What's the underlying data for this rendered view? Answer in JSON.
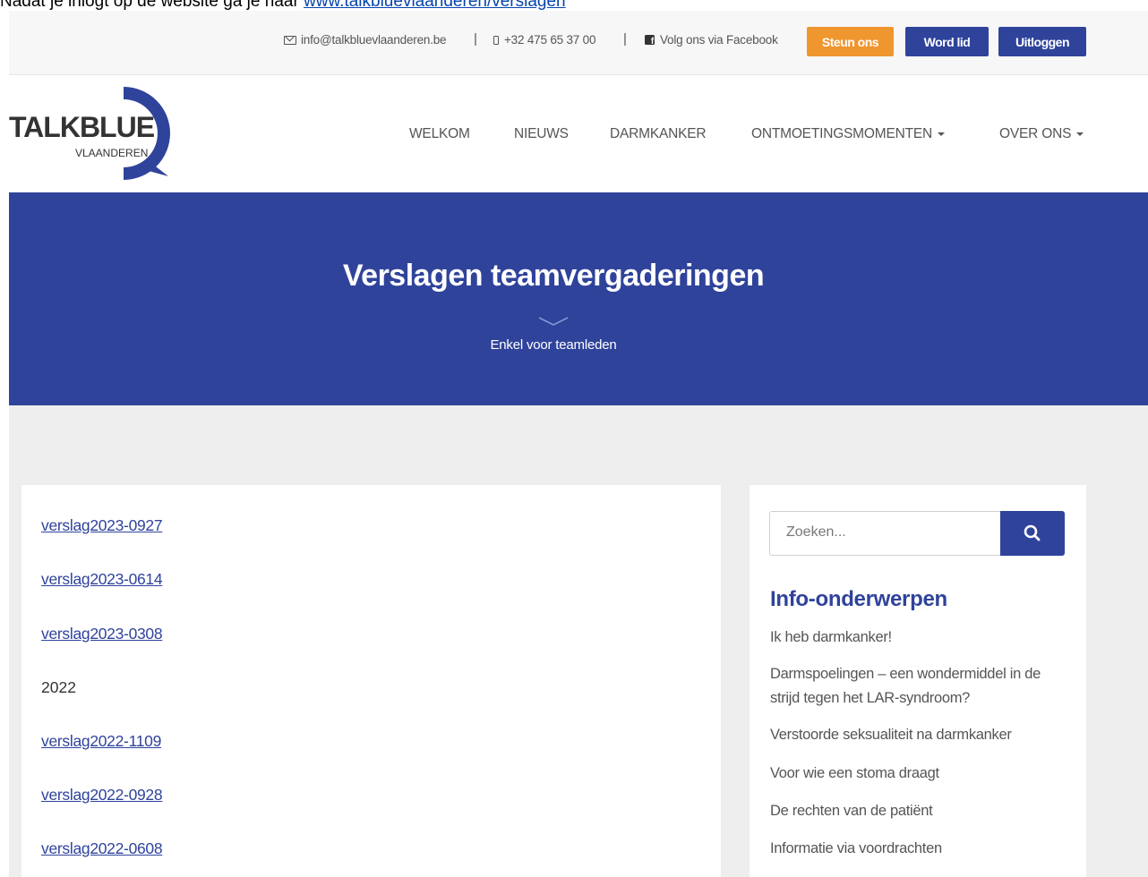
{
  "document": {
    "text": "Nadat je inlogt op de website ga je naar ",
    "link": "www.talkbluevlaanderen/verslagen"
  },
  "topbar": {
    "email": "info@talkbluevlaanderen.be",
    "phone": "+32 475 65 37 00",
    "facebook": "Volg ons via Facebook",
    "separator": "|",
    "buttons": {
      "donate": "Steun ons",
      "join": "Word lid",
      "logout": "Uitloggen"
    }
  },
  "logo": {
    "main": "TALKBLUE",
    "sub": "VLAANDEREN"
  },
  "nav": {
    "welcome": "WELKOM",
    "news": "NIEUWS",
    "cancer": "DARMKANKER",
    "meetings": "ONTMOETINGSMOMENTEN",
    "about": "OVER ONS"
  },
  "banner": {
    "title": "Verslagen teamvergaderingen",
    "subtitle": "Enkel voor teamleden"
  },
  "reports": [
    "verslag2023-0927",
    "verslag2023-0614",
    "verslag2023-0308",
    "2022",
    "verslag2022-1109",
    "verslag2022-0928",
    "verslag2022-0608"
  ],
  "sidebar": {
    "search_placeholder": "Zoeken...",
    "title": "Info-onderwerpen",
    "items": [
      "Ik heb darmkanker!",
      "Darmspoelingen – een wondermiddel in de strijd tegen het LAR-syndroom?",
      "Verstoorde seksualiteit na darmkanker",
      "Voor wie een stoma draagt",
      "De rechten van de patiënt",
      "Informatie via voordrachten"
    ]
  },
  "colors": {
    "brand_blue": "#2f439b",
    "accent_orange": "#f0962f",
    "content_bg": "#eeeeee"
  }
}
